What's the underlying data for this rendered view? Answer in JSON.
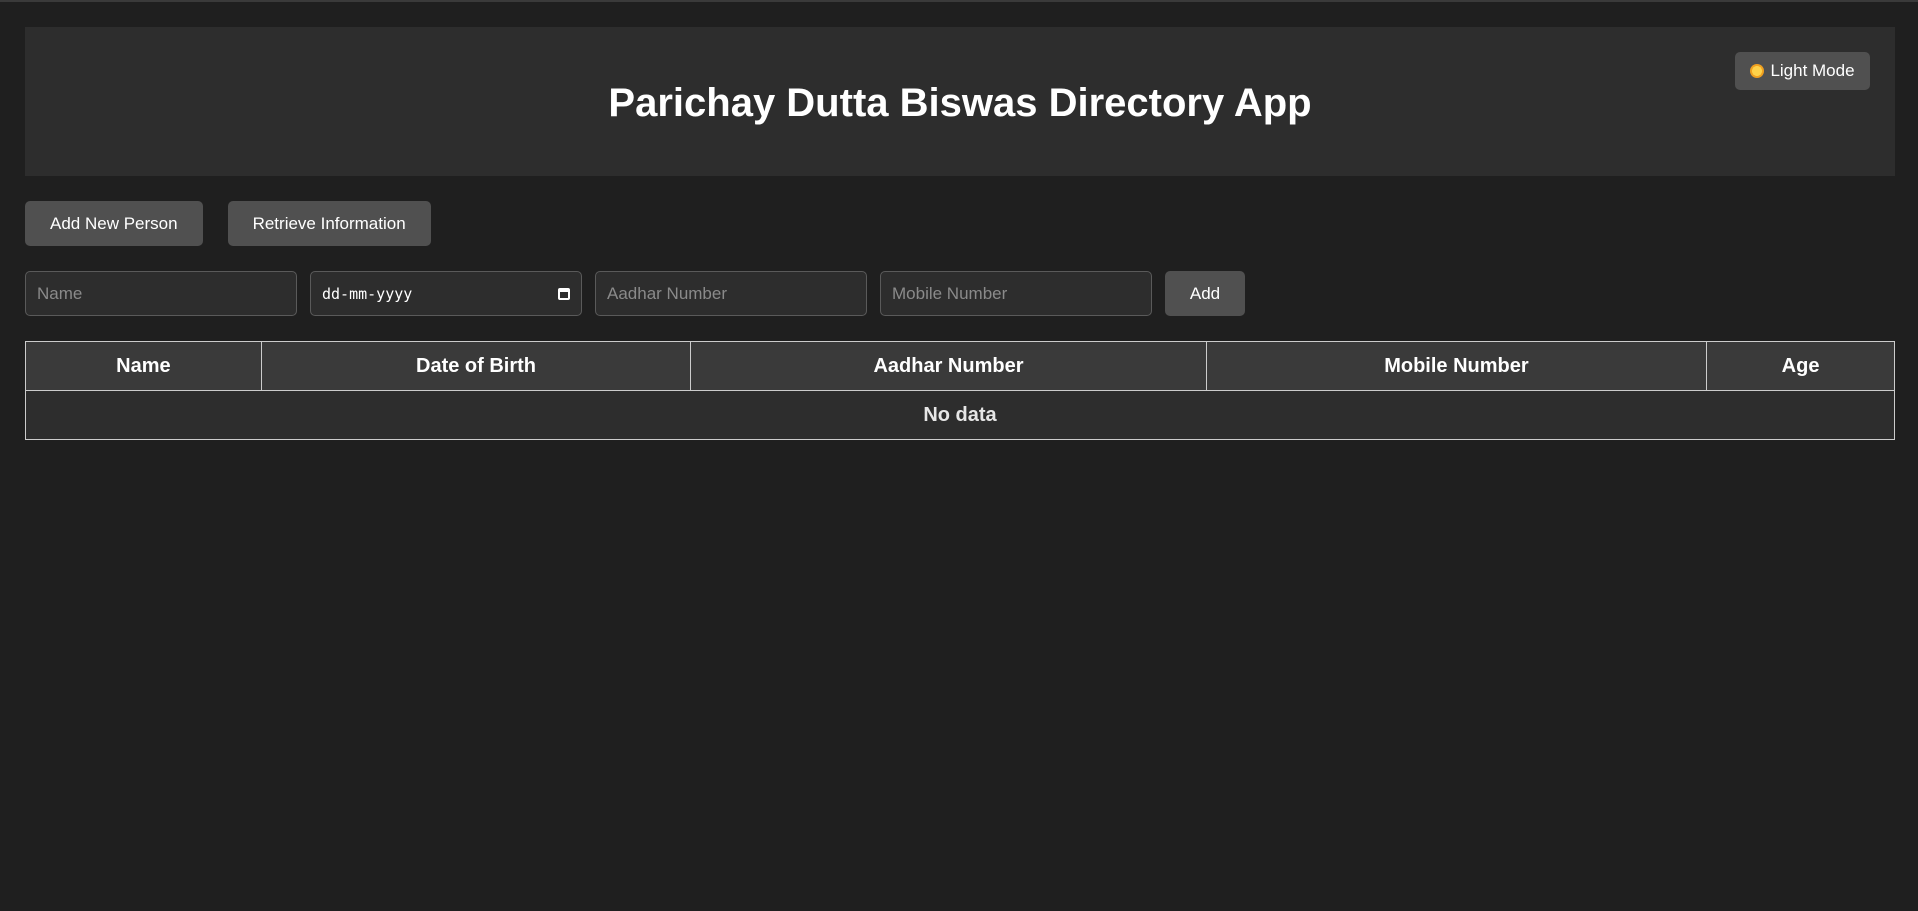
{
  "header": {
    "title": "Parichay Dutta Biswas Directory App",
    "theme_toggle_label": "Light Mode",
    "theme_icon": "sun-icon"
  },
  "actions": {
    "add_new_person": "Add New Person",
    "retrieve_information": "Retrieve Information"
  },
  "form": {
    "name_placeholder": "Name",
    "dob_placeholder": "dd-mm-yyyy",
    "aadhar_placeholder": "Aadhar Number",
    "mobile_placeholder": "Mobile Number",
    "add_label": "Add"
  },
  "table": {
    "columns": [
      "Name",
      "Date of Birth",
      "Aadhar Number",
      "Mobile Number",
      "Age"
    ],
    "empty_message": "No data"
  },
  "colors": {
    "background": "#1f1f1f",
    "header_bg": "#2d2d2d",
    "button_bg": "#505050"
  }
}
